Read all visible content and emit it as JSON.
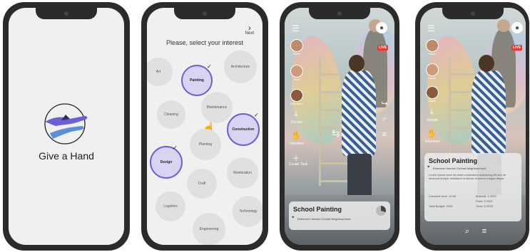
{
  "splash": {
    "brand": "Give a Hand"
  },
  "interests": {
    "title": "Please, select your interest",
    "next_label": "Next",
    "items": [
      {
        "label": "Art",
        "selected": false
      },
      {
        "label": "Painting",
        "selected": true
      },
      {
        "label": "Architecture",
        "selected": false
      },
      {
        "label": "Cleaning",
        "selected": false
      },
      {
        "label": "Maintenance",
        "selected": false
      },
      {
        "label": "Construction",
        "selected": true
      },
      {
        "label": "Planting",
        "selected": false
      },
      {
        "label": "Design",
        "selected": true
      },
      {
        "label": "Craft",
        "selected": false
      },
      {
        "label": "Restoration",
        "selected": false
      },
      {
        "label": "Logistics",
        "selected": false
      },
      {
        "label": "Technology",
        "selected": false
      },
      {
        "label": "Engineering",
        "selected": false
      }
    ]
  },
  "live_view": {
    "live_badge": "LIVE",
    "avatars": [
      "Name",
      "Name",
      "Send Name"
    ],
    "side_actions": [
      "Donate",
      "Volunteer",
      "Create Task"
    ],
    "campaign_title": "School Painting",
    "campaign_location": "Ebenezer Haerice Central Neighbourhood"
  },
  "detail_view": {
    "live_badge": "LIVE",
    "avatars": [
      "Name",
      "Name",
      "Name"
    ],
    "side_actions": [
      "Donate",
      "Volunteer"
    ],
    "campaign_title": "School Painting",
    "campaign_location": "Ebenezer Haerice Central Neighbourhood",
    "description": "Lorem ipsum dolor sit amet consectetur adipiscing elit sed do eiusmod tempor incididunt ut labore et dolore magna aliqua",
    "rows": [
      {
        "label": "Complete time: 12:00",
        "value": "Material: 5 2020"
      },
      {
        "label": "",
        "value": "Paint: 5 2020"
      },
      {
        "label": "Total Budget: 2000",
        "value": "Tools: 5 2020"
      }
    ]
  },
  "colors": {
    "accent": "#6b5fd3",
    "selected_fill": "#d8d4f2",
    "live_red": "#e53935",
    "phone_frame": "#2b2b2b"
  }
}
